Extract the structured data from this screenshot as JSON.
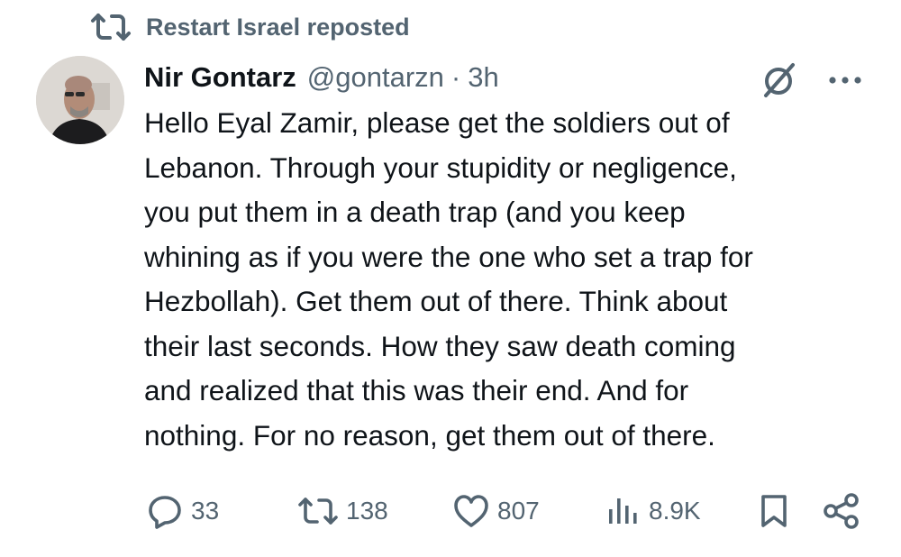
{
  "repost_banner": {
    "icon": "repost-icon",
    "text": "Restart Israel reposted"
  },
  "author": {
    "avatar": "avatar",
    "name": "Nir Gontarz",
    "handle": "@gontarzn",
    "separator": "·",
    "time": "3h"
  },
  "header_icons": {
    "grok": "grok-icon",
    "more": "more-icon"
  },
  "tweet": {
    "lines": [
      "Hello Eyal Zamir, please get the soldiers out of",
      "Lebanon. Through your stupidity or negligence,",
      "you put them in a death trap (and you keep",
      "whining as if you were the one who set a trap for",
      "Hezbollah). Get them out of there. Think about",
      "their last seconds. How they saw death coming",
      "and realized that this was their end. And for",
      "nothing. For no reason, get them out of there."
    ]
  },
  "actions": {
    "replies": "33",
    "reposts": "138",
    "likes": "807",
    "views": "8.9K"
  },
  "colors": {
    "text": "#0f1419",
    "secondary": "#536471",
    "background": "#ffffff"
  }
}
